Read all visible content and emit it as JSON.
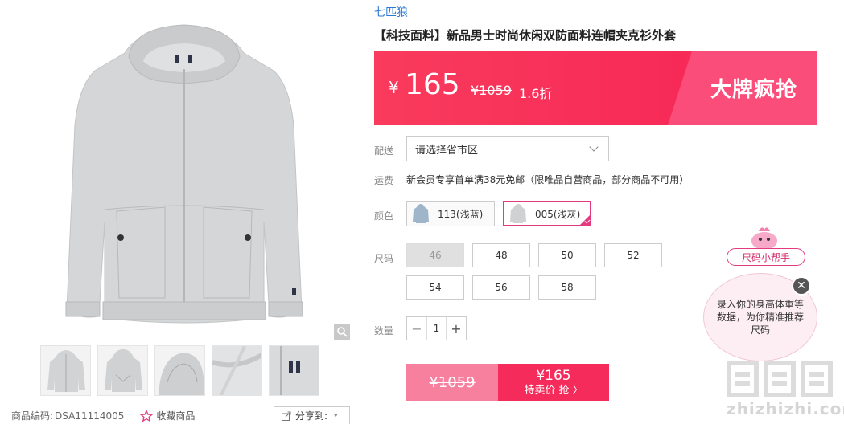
{
  "gallery": {
    "thumbnail_count": 5,
    "product_code_label": "商品编码:",
    "product_code": "DSA11114005",
    "favorite_label": "收藏商品",
    "share_label": "分享到:"
  },
  "product": {
    "brand": "七匹狼",
    "title": "【科技面料】新品男士时尚休闲双防面料连帽夹克衫外套"
  },
  "price": {
    "currency": "¥",
    "current": "165",
    "original": "¥1059",
    "discount": "1.6折",
    "promo_text": "大牌疯抢",
    "colors": {
      "banner": "#f72a57",
      "accent": "#e43a7f"
    }
  },
  "delivery": {
    "label": "配送",
    "placeholder": "请选择省市区"
  },
  "shipping": {
    "label": "运费",
    "text": "新会员专享首单满38元免邮（限唯品自营商品，部分商品不可用）"
  },
  "color": {
    "label": "颜色",
    "options": [
      {
        "label": "113(浅蓝)",
        "selected": false
      },
      {
        "label": "005(浅灰)",
        "selected": true
      }
    ]
  },
  "size": {
    "label": "尺码",
    "options": [
      "46",
      "48",
      "50",
      "52",
      "54",
      "56",
      "58"
    ],
    "disabled": [
      "46"
    ]
  },
  "quantity": {
    "label": "数量",
    "value": "1",
    "minus": "−",
    "plus": "+"
  },
  "buy": {
    "original": "¥1059",
    "price": "¥165",
    "label": "特卖价 抢 〉"
  },
  "helper": {
    "tag": "尺码小帮手",
    "text": "录入你的身高体重等数据，为你精准推荐尺码",
    "close": "✕"
  },
  "watermark": {
    "text": "zhizhizhi.com"
  }
}
